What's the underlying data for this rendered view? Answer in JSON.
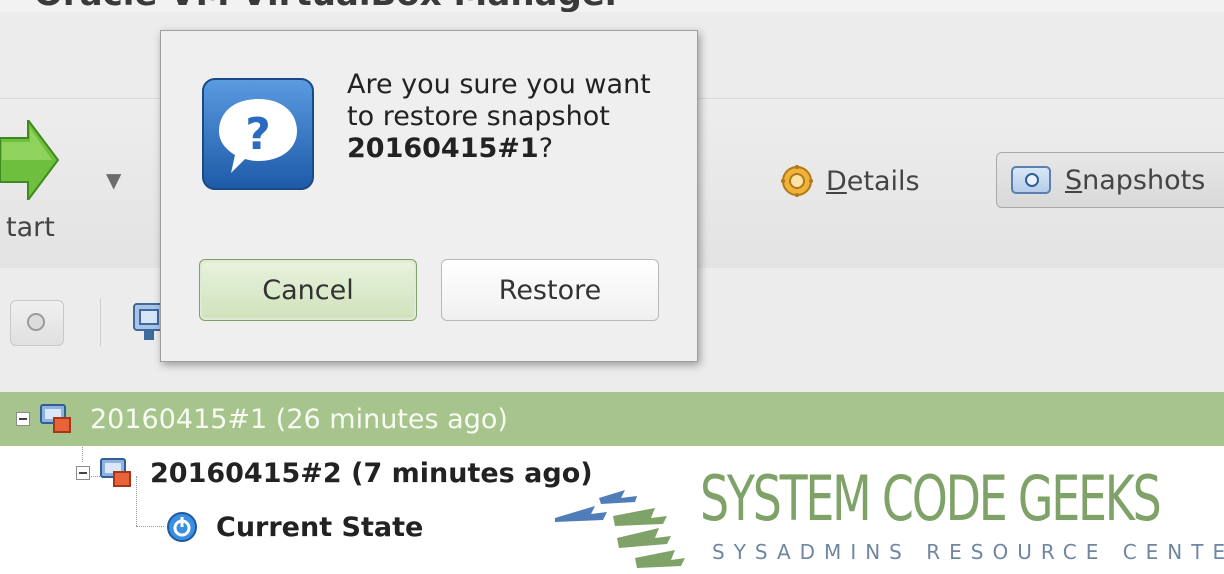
{
  "window": {
    "title": "Oracle VM VirtualBox Manager"
  },
  "toolbar": {
    "start_label": "tart",
    "details_label": "Details",
    "details_mnemonic": "D",
    "snapshots_label": "Snapshots",
    "snapshots_mnemonic": "S"
  },
  "dialog": {
    "message_prefix": "Are you sure you want to restore snapshot ",
    "snapshot_name": "20160415#1",
    "message_suffix": "?",
    "cancel_label": "Cancel",
    "restore_label": "Restore"
  },
  "tree": {
    "items": [
      {
        "label": "20160415#1 (26 minutes ago)",
        "selected": true
      },
      {
        "label": "20160415#2 (7 minutes ago)",
        "bold": true
      },
      {
        "label": "Current State",
        "bold": true
      }
    ]
  },
  "watermark": {
    "title": "SYSTEM CODE GEEKS",
    "subtitle": "SYSADMINS RESOURCE CENTER"
  },
  "colors": {
    "selection": "#a7c48d",
    "dialog_bg": "#efefef",
    "accent_blue": "#2f6fbf",
    "watermark_green": "#7fa268"
  },
  "icons": [
    "start-arrow-icon",
    "dropdown-icon",
    "gear-icon",
    "snapshot-camera-icon",
    "question-icon",
    "snapshot-node-icon",
    "current-state-icon"
  ]
}
